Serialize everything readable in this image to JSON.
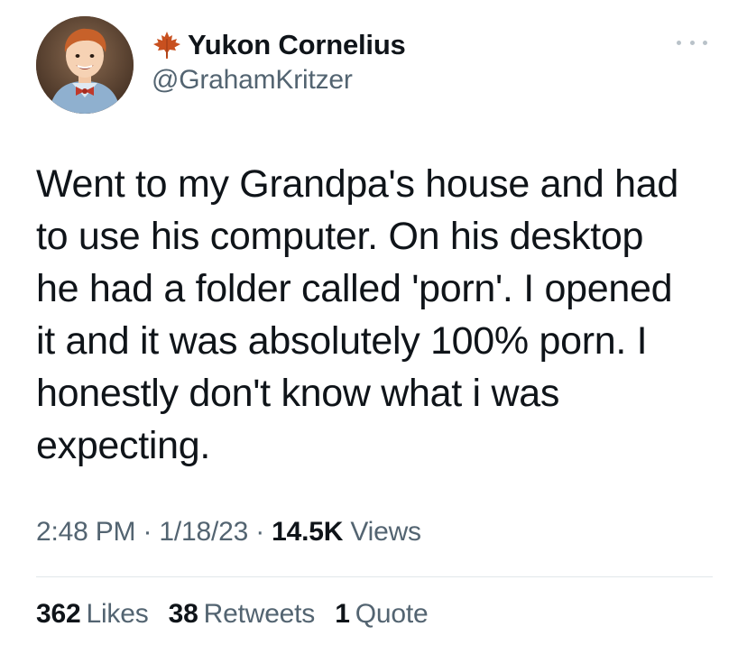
{
  "author": {
    "display_name": "Yukon Cornelius",
    "handle": "@GrahamKritzer",
    "badge_icon": "maple-leaf-icon",
    "avatar_icon": "profile-photo"
  },
  "tweet": {
    "text": "Went to my Grandpa's house and had\nto use his computer. On his desktop\nhe had a folder called 'porn'. I opened\nit and it was absolutely 100% porn. I\nhonestly don't know what i was\nexpecting."
  },
  "meta": {
    "time": "2:48 PM",
    "sep1": " · ",
    "date": "1/18/23",
    "sep2": " · ",
    "views_count": "14.5K",
    "views_label": " Views"
  },
  "stats": {
    "likes_count": "362",
    "likes_label": "Likes",
    "retweets_count": "38",
    "retweets_label": "Retweets",
    "quotes_count": "1",
    "quotes_label": "Quote"
  },
  "colors": {
    "text_primary": "#0f1419",
    "text_secondary": "#536471",
    "divider": "#e1e7ea",
    "leaf_fill": "#c8501f"
  },
  "more_menu_icon": "more-horizontal-icon"
}
